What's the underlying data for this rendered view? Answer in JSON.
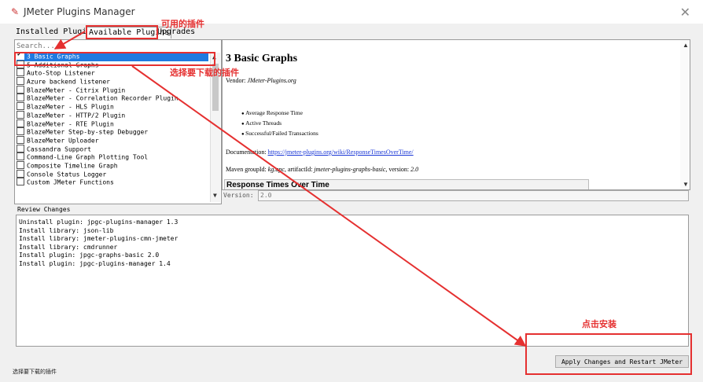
{
  "window": {
    "title": "JMeter Plugins Manager",
    "close_glyph": "✕"
  },
  "tabs": [
    {
      "label": "Installed Plugins"
    },
    {
      "label": "Available Plugins"
    },
    {
      "label": "Upgrades"
    }
  ],
  "search": {
    "placeholder": "Search..."
  },
  "plugins": [
    {
      "label": "3 Basic Graphs",
      "checked": true,
      "selected": true
    },
    {
      "label": "5 Additional Graphs",
      "checked": false
    },
    {
      "label": "Auto-Stop Listener",
      "checked": false
    },
    {
      "label": "Azure backend listener",
      "checked": false
    },
    {
      "label": "BlazeMeter - Citrix Plugin",
      "checked": false
    },
    {
      "label": "BlazeMeter - Correlation Recorder Plugin",
      "checked": false
    },
    {
      "label": "BlazeMeter - HLS Plugin",
      "checked": false
    },
    {
      "label": "BlazeMeter - HTTP/2 Plugin",
      "checked": false
    },
    {
      "label": "BlazeMeter - RTE Plugin",
      "checked": false
    },
    {
      "label": "BlazeMeter Step-by-step Debugger",
      "checked": false
    },
    {
      "label": "BlazeMeter Uploader",
      "checked": false
    },
    {
      "label": "Cassandra Support",
      "checked": false
    },
    {
      "label": "Command-Line Graph Plotting Tool",
      "checked": false
    },
    {
      "label": "Composite Timeline Graph",
      "checked": false
    },
    {
      "label": "Console Status Logger",
      "checked": false
    },
    {
      "label": "Custom JMeter Functions",
      "checked": false
    }
  ],
  "details": {
    "title": "3 Basic Graphs",
    "vendor_label": "Vendor: ",
    "vendor": "JMeter-Plugins.org",
    "bullets": [
      "Average Response Time",
      "Active Threads",
      "Successful/Failed Transactions"
    ],
    "doc_label": "Documentation: ",
    "doc_link": "https://jmeter-plugins.org/wiki/ResponseTimesOverTime/",
    "maven_label": "Maven groupId: ",
    "maven_group": "kg.apc",
    "maven_artifact_label": ", artifactId: ",
    "maven_artifact": "jmeter-plugins-graphs-basic",
    "maven_version_label": ", version: ",
    "maven_version": "2.0",
    "preview_heading": "Response Times Over Time"
  },
  "version": {
    "label": "Version:",
    "value": "2.0"
  },
  "review": {
    "label": "Review Changes",
    "lines": [
      "Uninstall plugin: jpgc-plugins-manager 1.3",
      "Install library: json-lib",
      "Install library: jmeter-plugins-cmn-jmeter",
      "Install library: cmdrunner",
      "Install plugin: jpgc-graphs-basic 2.0",
      "Install plugin: jpgc-plugins-manager 1.4"
    ]
  },
  "apply_button": {
    "label": "Apply Changes and Restart JMeter"
  },
  "status_text": "选择要下载的插件",
  "annotations": {
    "available_tab": "可用的插件",
    "select_plugin": "选择要下载的插件",
    "click_install": "点击安装",
    "color": "#e53030"
  },
  "colors": {
    "selection": "#1f7ae0",
    "link": "#1a37d6"
  }
}
